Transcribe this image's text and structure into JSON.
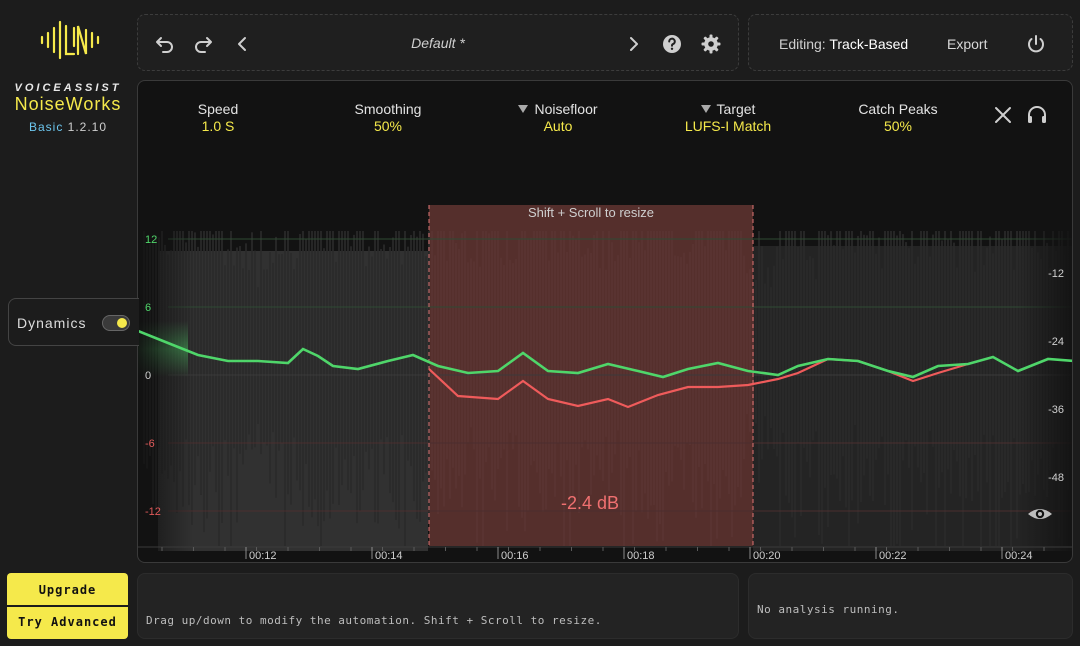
{
  "brand": {
    "top": "VOICEASSIST",
    "name": "NoiseWorks",
    "tier": "Basic",
    "version": "1.2.10",
    "accent": "#f5e94b"
  },
  "sidebar": {
    "dynamics_label": "Dynamics",
    "dynamics_on": true,
    "upgrade_label": "Upgrade",
    "try_label": "Try Advanced"
  },
  "toolbar": {
    "preset": "Default *",
    "icons": [
      "undo-icon",
      "redo-icon",
      "prev-preset-icon",
      "next-preset-icon",
      "help-icon",
      "settings-icon"
    ]
  },
  "topright": {
    "editing_label": "Editing:",
    "editing_value": "Track-Based",
    "export_label": "Export",
    "power_icon": "power-icon"
  },
  "params": [
    {
      "label": "Speed",
      "value": "1.0 S",
      "dropdown": false
    },
    {
      "label": "Smoothing",
      "value": "50%",
      "dropdown": false
    },
    {
      "label": "Noisefloor",
      "value": "Auto",
      "dropdown": true
    },
    {
      "label": "Target",
      "value": "LUFS-I Match",
      "dropdown": true
    },
    {
      "label": "Catch Peaks",
      "value": "50%",
      "dropdown": false
    }
  ],
  "graph": {
    "hint": "Shift + Scroll to resize",
    "selection_db": "-2.4 dB",
    "left_axis": [
      "12",
      "6",
      "0",
      "-6",
      "-12"
    ],
    "left_axis_colors": [
      "#4fd66a",
      "#4fd66a",
      "#cfcfcf",
      "#e05a5a",
      "#e05a5a"
    ],
    "right_axis": [
      "-12",
      "-24",
      "-36",
      "-48"
    ],
    "time_labels": [
      "00:12",
      "00:14",
      "00:16",
      "00:18",
      "00:20",
      "00:22",
      "00:24"
    ],
    "colors": {
      "green": "#4fd66a",
      "red": "#ef5b5b",
      "selection": "#7a3f3a"
    }
  },
  "status": {
    "left": "Drag up/down to modify the automation. Shift + Scroll to resize.",
    "right": "No analysis running."
  }
}
